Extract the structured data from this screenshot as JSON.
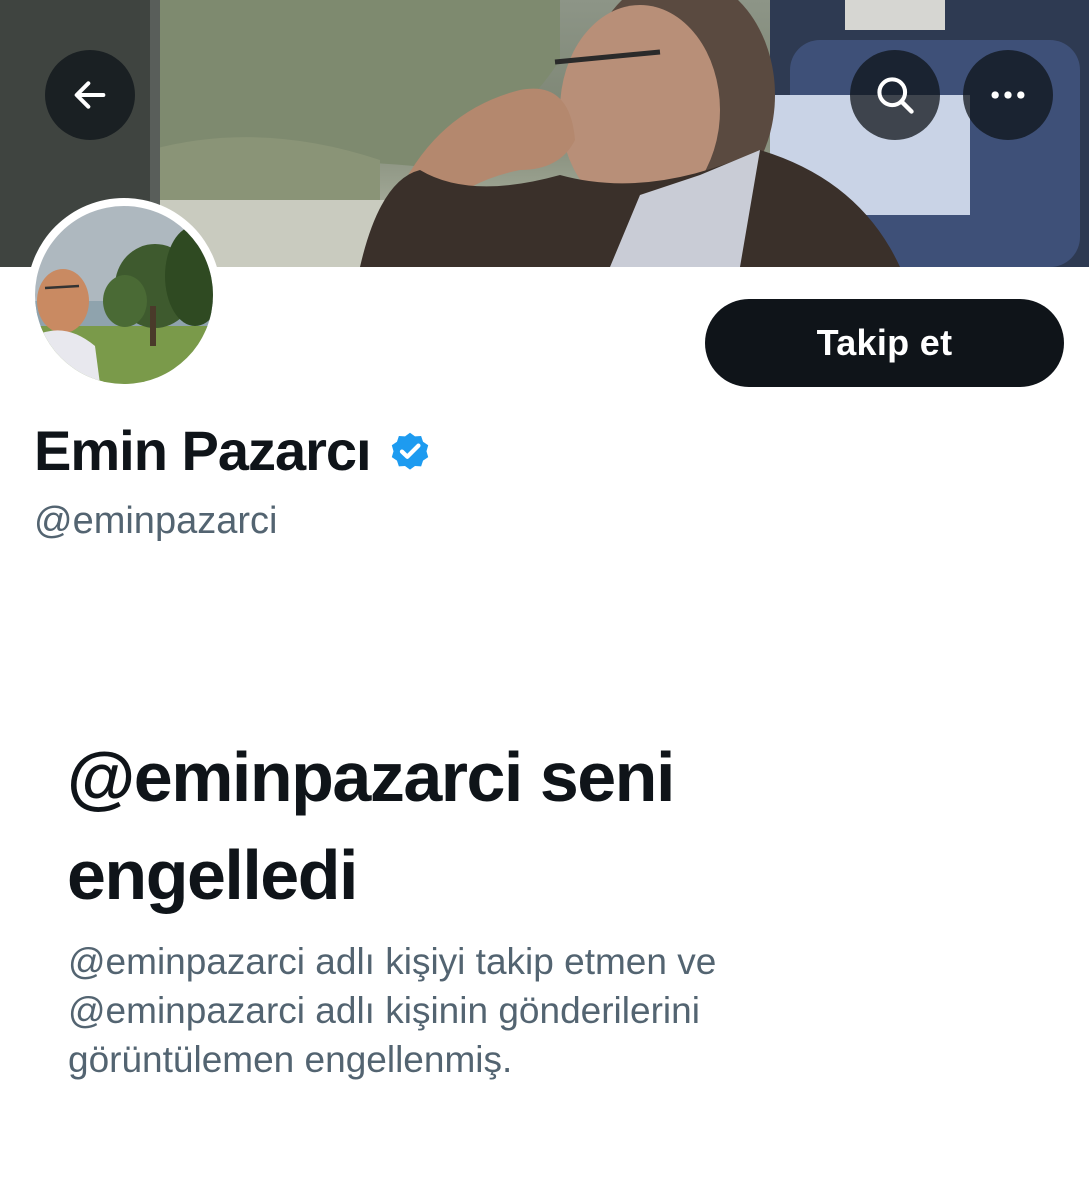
{
  "header": {
    "back_icon": "arrow-left-icon",
    "search_icon": "search-icon",
    "more_icon": "more-horizontal-icon"
  },
  "profile": {
    "display_name": "Emin Pazarcı",
    "handle": "@eminpazarci",
    "verified_icon": "verified-badge-icon",
    "verified_color": "#1d9bf0",
    "follow_label": "Takip et"
  },
  "blocked": {
    "title": "@eminpazarci seni engelledi",
    "description": "@eminpazarci adlı kişiyi takip etmen ve @eminpazarci adlı kişinin gönderilerini görüntülemen engellenmiş."
  },
  "colors": {
    "primary_text": "#0f1419",
    "secondary_text": "#536471",
    "button_bg": "#0f1419",
    "button_text": "#ffffff"
  }
}
